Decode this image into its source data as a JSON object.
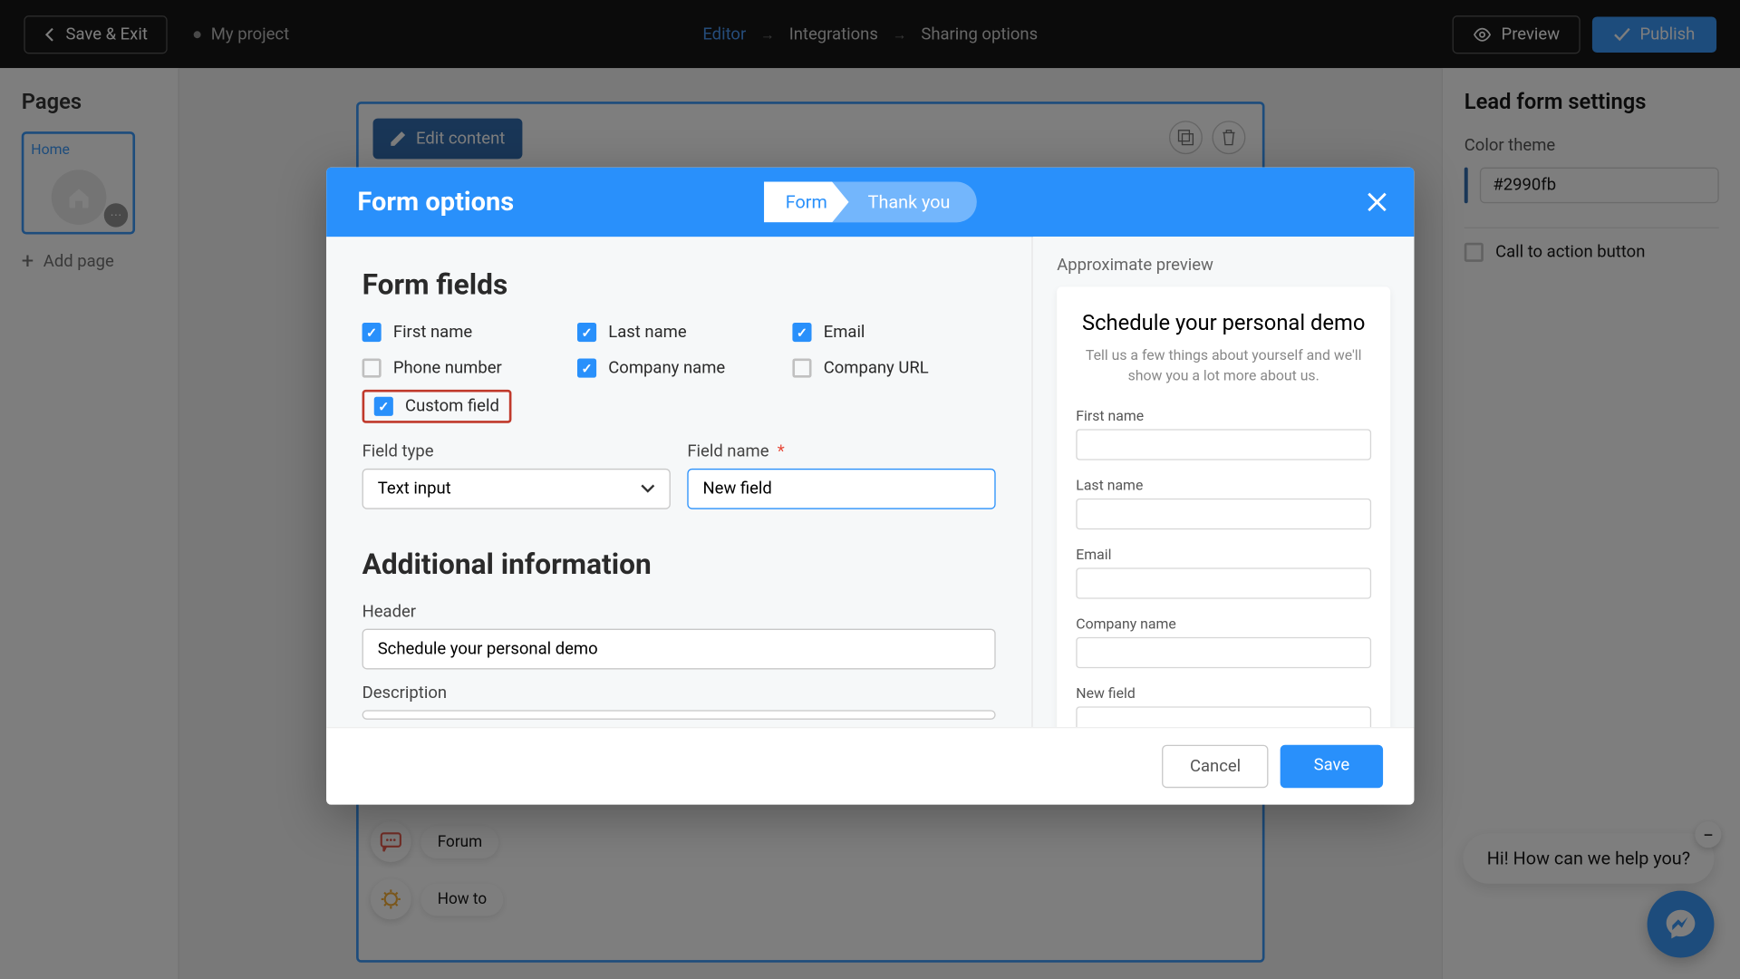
{
  "topbar": {
    "save_exit": "Save & Exit",
    "project": "My project",
    "breadcrumbs": [
      "Editor",
      "Integrations",
      "Sharing options"
    ],
    "preview": "Preview",
    "publish": "Publish"
  },
  "left": {
    "pages": "Pages",
    "home": "Home",
    "add_page": "Add page"
  },
  "canvas": {
    "edit_content": "Edit content",
    "title": "Schedule your personal demo"
  },
  "right": {
    "title": "Lead form settings",
    "color_theme": "Color theme",
    "color_value": "#2990fb",
    "cta": "Call to action button"
  },
  "help": {
    "forum": "Forum",
    "howto": "How to",
    "chat": "Hi! How can we help you?"
  },
  "modal": {
    "title": "Form options",
    "tab_form": "Form",
    "tab_thank": "Thank you",
    "section_fields": "Form fields",
    "fields": {
      "first_name": {
        "label": "First name",
        "checked": true
      },
      "last_name": {
        "label": "Last name",
        "checked": true
      },
      "email": {
        "label": "Email",
        "checked": true
      },
      "phone": {
        "label": "Phone number",
        "checked": false
      },
      "company": {
        "label": "Company name",
        "checked": true
      },
      "company_url": {
        "label": "Company URL",
        "checked": false
      },
      "custom": {
        "label": "Custom field",
        "checked": true
      }
    },
    "field_type_label": "Field type",
    "field_type_value": "Text input",
    "field_name_label": "Field name",
    "field_name_value": "New field",
    "section_additional": "Additional information",
    "header_label": "Header",
    "header_value": "Schedule your personal demo",
    "desc_label": "Description",
    "preview_label": "Approximate preview",
    "preview": {
      "title": "Schedule your personal demo",
      "sub": "Tell us a few things about yourself and we'll show you a lot more about us.",
      "fields": [
        "First name",
        "Last name",
        "Email",
        "Company name",
        "New field"
      ]
    },
    "cancel": "Cancel",
    "save": "Save"
  }
}
